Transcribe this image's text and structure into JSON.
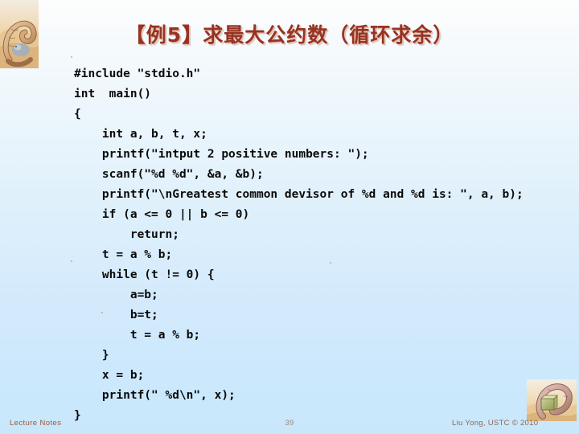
{
  "slide": {
    "title": "【例5】求最大公约数（循环求余）",
    "background_top_color": "#fdfdfd",
    "background_bottom_color": "#c9e7fb",
    "title_color": "#973322"
  },
  "code": {
    "language": "c",
    "lines": [
      "#include \"stdio.h\"",
      "int  main()",
      "{",
      "    int a, b, t, x;",
      "    printf(\"intput 2 positive numbers: \");",
      "    scanf(\"%d %d\", &a, &b);",
      "    printf(\"\\nGreatest common devisor of %d and %d is: \", a, b);",
      "    if (a <= 0 || b <= 0)",
      "        return;",
      "    t = a % b;",
      "    while (t != 0) {",
      "        a=b;",
      "        b=t;",
      "        t = a % b;",
      "    }",
      "    x = b;",
      "    printf(\" %d\\n\", x);",
      "}"
    ]
  },
  "footer": {
    "left_label": "Lecture Notes",
    "page_number": "39",
    "copyright": "Liu Yong, USTC © 2010"
  },
  "decorations": {
    "top_left_art": "curled-snake-illustration",
    "bottom_right_art": "curled-snake-with-box-illustration"
  }
}
